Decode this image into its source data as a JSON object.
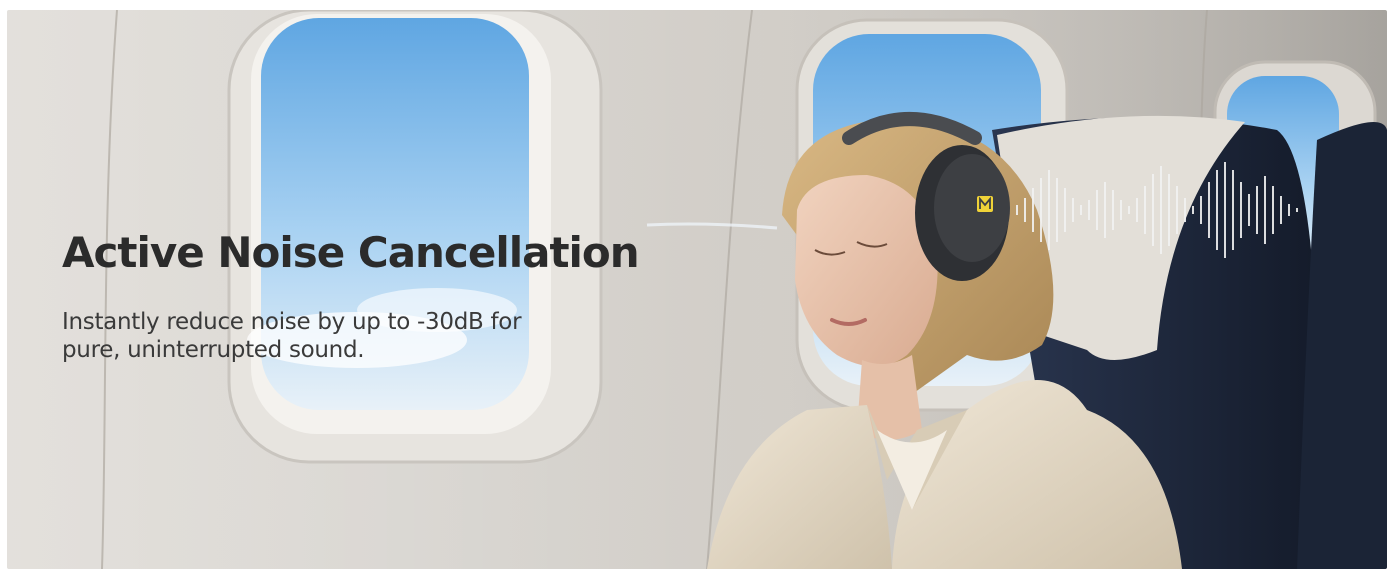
{
  "banner": {
    "headline": "Active Noise Cancellation",
    "description": "Instantly reduce noise by up to -30dB for pure, uninterrupted sound.",
    "colors": {
      "cabin_wall": "#d6d3ce",
      "sky": "#8cc3ec",
      "jacket": "#e6dbc8",
      "seat": "#1f2a3e",
      "headphones": "#3d3f43",
      "logo": "#f0d338",
      "text": "#2b2b2b"
    },
    "icons": {
      "brand_logo": "brand-logo-icon",
      "sound_wave": "sound-wave-icon"
    }
  }
}
